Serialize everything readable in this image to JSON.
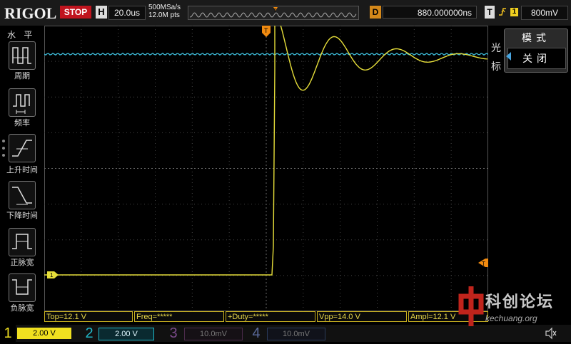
{
  "brand": "RIGOL",
  "run_state": "STOP",
  "horizontal": {
    "label": "H",
    "timebase": "20.0us",
    "sample_rate": "500MSa/s",
    "memory_depth": "12.0M pts"
  },
  "delay": {
    "label": "D",
    "value": "880.000000ns"
  },
  "trigger": {
    "label": "T",
    "edge_icon": "rising-edge-icon",
    "source": "1",
    "level": "800mV"
  },
  "left_menu": {
    "title": "水 平",
    "items": [
      {
        "label": "周期",
        "icon": "period-icon"
      },
      {
        "label": "频率",
        "icon": "frequency-icon"
      },
      {
        "label": "上升时间",
        "icon": "rise-time-icon"
      },
      {
        "label": "下降时间",
        "icon": "fall-time-icon"
      },
      {
        "label": "正脉宽",
        "icon": "positive-width-icon"
      },
      {
        "label": "负脉宽",
        "icon": "negative-width-icon"
      }
    ]
  },
  "cursor_menu": {
    "title": "光标",
    "mode_title": "模式",
    "mode_value": "关闭"
  },
  "measurements": [
    {
      "label": "Top=12.1 V"
    },
    {
      "label": "Freq=*****"
    },
    {
      "label": "+Duty=*****"
    },
    {
      "label": "Vpp=14.0 V"
    },
    {
      "label": "Ampl=12.1 V"
    }
  ],
  "channels": [
    {
      "num": "1",
      "scale": "2.00 V",
      "color": "#f0e020",
      "active": true
    },
    {
      "num": "2",
      "scale": "2.00 V",
      "color": "#20b8c8",
      "active": true
    },
    {
      "num": "3",
      "scale": "10.0mV",
      "color": "#7a4a8a",
      "active": false
    },
    {
      "num": "4",
      "scale": "10.0mV",
      "color": "#4a5a8a",
      "active": false
    }
  ],
  "ch1_marker": "1",
  "trigger_marker": "T",
  "colors": {
    "ch1": "#e6de3a",
    "ch2": "#3ab4d0",
    "trigger": "#f08a10",
    "stop": "#c0141e"
  },
  "watermark": {
    "name": "科创论坛",
    "url": "kechuang.org"
  }
}
